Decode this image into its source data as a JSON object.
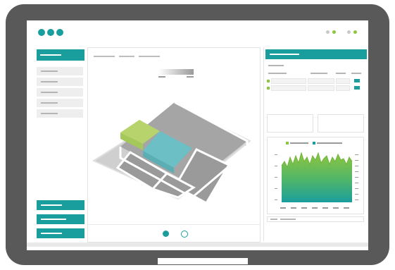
{
  "device": {
    "type": "tablet-frame"
  },
  "window": {
    "left_dots": [
      "dot",
      "dot",
      "dot"
    ],
    "right_indicators": [
      {
        "colors": [
          "#c8c8c8",
          "#8dc63f"
        ]
      },
      {
        "colors": [
          "#c8c8c8",
          "#8dc63f"
        ]
      }
    ]
  },
  "sidebar": {
    "header_color": "#1a9e9d",
    "items": [
      "item",
      "item",
      "item",
      "item",
      "item"
    ],
    "bottom_buttons": [
      "button",
      "button",
      "button"
    ]
  },
  "main": {
    "breadcrumb_segments": 3,
    "floorplan_rooms": [
      {
        "name": "room-green",
        "color": "#a5c85a"
      },
      {
        "name": "room-teal",
        "color": "#5aaeb4"
      },
      {
        "name": "room-grey-large",
        "color": "#9a9a9a"
      },
      {
        "name": "room-grey-small",
        "color": "#9a9a9a"
      },
      {
        "name": "room-grey-corridor",
        "color": "#9a9a9a"
      }
    ],
    "pagination": {
      "pages": 2,
      "active_index": 0
    }
  },
  "right_panel": {
    "table_rows": 2,
    "legend_colors": [
      "#8dc63f",
      "#1a9e9d"
    ],
    "chart_colors": [
      "#8dc63f",
      "#1a9e9d"
    ]
  },
  "colors": {
    "accent": "#1a9e9d",
    "green": "#8dc63f",
    "frame": "#595959"
  }
}
